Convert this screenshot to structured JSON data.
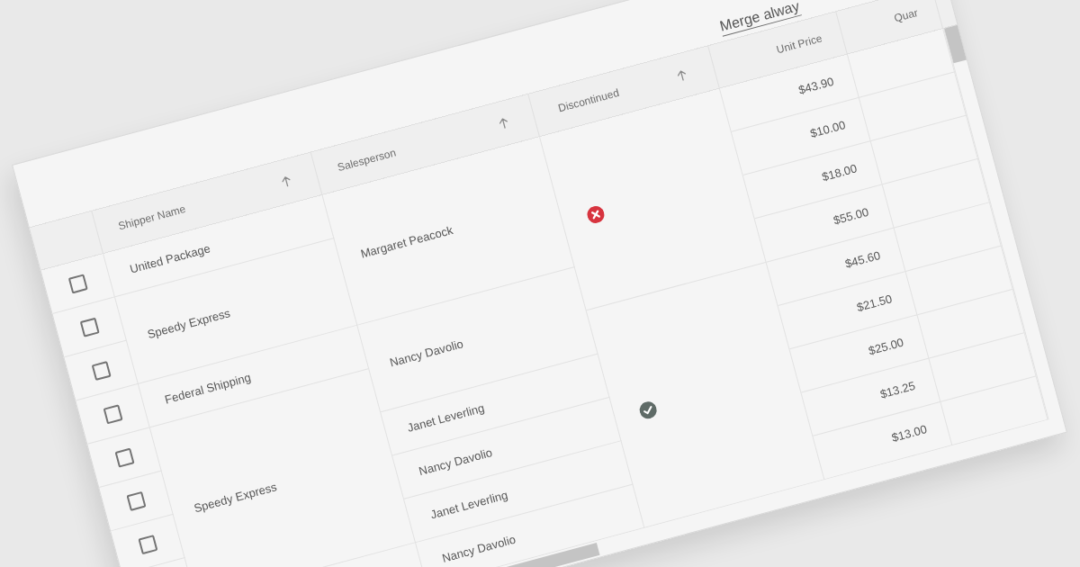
{
  "grid_toolbar": {
    "merge_mode_select": {
      "value": "Merge alway"
    }
  },
  "columns": [
    {
      "kind": "checkbox",
      "sorted": false
    },
    {
      "kind": "text",
      "label": "Shipper Name",
      "sorted": true
    },
    {
      "kind": "text",
      "label": "Salesperson",
      "sorted": true
    },
    {
      "kind": "boolean",
      "label": "Discontinued",
      "sorted": true
    },
    {
      "kind": "number",
      "label": "Unit Price",
      "sorted": false
    },
    {
      "kind": "number",
      "label": "Quar",
      "sorted": false
    }
  ],
  "rows": [
    {
      "checked": false,
      "cells": [
        {
          "text": "United Package"
        },
        {
          "text": "Margaret Peacock"
        },
        {
          "value": false
        },
        "$43.90"
      ]
    },
    {
      "checked": false,
      "cells": [
        {
          "merged_up": false,
          "text": "Speedy Express"
        },
        {
          "merged_up": true
        },
        {
          "merged_up": true
        },
        "$10.00"
      ]
    },
    {
      "checked": false,
      "cells": [
        {
          "merged_up": true
        },
        {
          "merged_up": true
        },
        {
          "merged_up": true
        },
        "$18.00"
      ]
    },
    {
      "checked": false,
      "cells": [
        {
          "merged_up": false,
          "text": "Federal Shipping"
        },
        {
          "merged_up": false,
          "text": "Nancy Davolio"
        },
        {
          "merged_up": true
        },
        "$55.00"
      ]
    },
    {
      "checked": false,
      "cells": [
        {
          "merged_up": false,
          "text": "Speedy Express"
        },
        {
          "merged_up": true
        },
        {
          "merged_up": false,
          "value": true
        },
        "$45.60"
      ]
    },
    {
      "checked": false,
      "cells": [
        {
          "merged_up": true
        },
        {
          "merged_up": false,
          "text": "Janet Leverling"
        },
        {
          "merged_up": true
        },
        "$21.50"
      ]
    },
    {
      "checked": false,
      "cells": [
        {
          "merged_up": true
        },
        {
          "merged_up": false,
          "text": "Nancy Davolio"
        },
        {
          "merged_up": true
        },
        "$25.00"
      ]
    },
    {
      "cells": [
        {
          "merged_up": true
        },
        {
          "merged_up": false,
          "text": "Janet Leverling"
        },
        {
          "merged_up": true
        },
        "$13.25"
      ]
    },
    {
      "cells": [
        {
          "merged_up": false
        },
        {
          "merged_up": false,
          "text": "Nancy Davolio"
        },
        {
          "merged_up": true
        },
        "$13.00"
      ]
    }
  ]
}
